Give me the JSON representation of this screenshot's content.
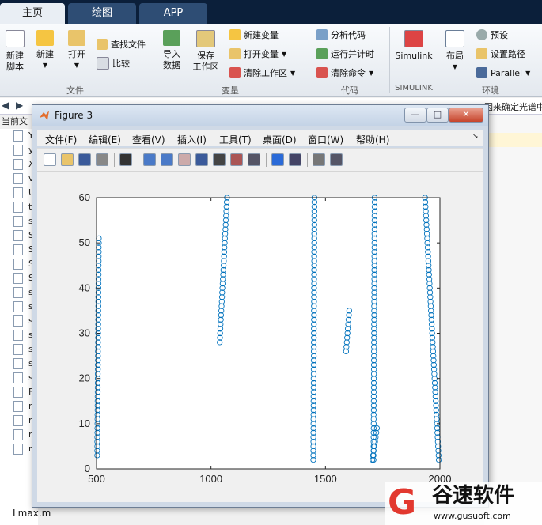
{
  "ribbon": {
    "tabs": [
      "主页",
      "绘图",
      "APP"
    ],
    "buttons": {
      "new_script": "新建\n脚本",
      "new": "新建",
      "open": "打开",
      "find_files": "查找文件",
      "compare": "比较",
      "import": "导入\n数据",
      "save_workspace": "保存\n工作区",
      "new_variable": "新建变量",
      "open_variable": "打开变量",
      "clear_workspace": "清除工作区",
      "analyze_code": "分析代码",
      "run_time": "运行并计时",
      "clear_commands": "清除命令",
      "simulink": "Simulink",
      "layout": "布局",
      "preferences": "预设",
      "set_path": "设置路径",
      "parallel": "Parallel"
    },
    "groups": [
      "文件",
      "变量",
      "代码",
      "SIMULINK",
      "环境"
    ]
  },
  "desktop": {
    "current_folder_label": "当前文",
    "path_tail": "因来确定光谱中",
    "file_initials": [
      "Y",
      "y",
      "X",
      "v",
      "U",
      "t",
      "s",
      "S",
      "S",
      "S",
      "S",
      "s",
      "s",
      "s",
      "s",
      "s",
      "s",
      "s",
      "F",
      "r",
      "r",
      "r",
      "r"
    ],
    "last_file": "Lmax.m"
  },
  "figure": {
    "title": "Figure 3",
    "controls": {
      "minimize": "—",
      "maximize": "□",
      "close": "✕"
    },
    "menus": [
      "文件(F)",
      "编辑(E)",
      "查看(V)",
      "插入(I)",
      "工具(T)",
      "桌面(D)",
      "窗口(W)",
      "帮助(H)"
    ],
    "toolbar_icons": [
      "new-figure-icon",
      "open-icon",
      "save-icon",
      "print-icon",
      "pointer-icon",
      "zoom-in-icon",
      "zoom-out-icon",
      "pan-icon",
      "rotate-icon",
      "data-cursor-icon",
      "brush-icon",
      "link-icon",
      "colorbar-icon",
      "legend-icon",
      "hide-plot-tools-icon",
      "show-plot-tools-icon"
    ]
  },
  "chart_data": {
    "type": "scatter",
    "marker": "open-circle",
    "color": "#0072bd",
    "xlim": [
      500,
      2000
    ],
    "ylim": [
      0,
      60
    ],
    "xticks": [
      500,
      1000,
      1500,
      2000
    ],
    "yticks": [
      0,
      10,
      20,
      30,
      40,
      50,
      60
    ],
    "title": "",
    "xlabel": "",
    "ylabel": "",
    "series": [
      {
        "x_start": 503,
        "x_end": 510,
        "y_start": 3,
        "y_end": 51,
        "count": 49
      },
      {
        "x_start": 1038,
        "x_end": 1070,
        "y_start": 28,
        "y_end": 60,
        "count": 33
      },
      {
        "x_start": 1447,
        "x_end": 1452,
        "y_start": 2,
        "y_end": 60,
        "count": 59
      },
      {
        "x_start": 1590,
        "x_end": 1604,
        "y_start": 26,
        "y_end": 35,
        "count": 10
      },
      {
        "x_start": 1710,
        "x_end": 1715,
        "y_start": 2,
        "y_end": 60,
        "count": 59
      },
      {
        "x_start": 1705,
        "x_end": 1725,
        "y_start": 2,
        "y_end": 9,
        "count": 8
      },
      {
        "x_start": 1995,
        "x_end": 1935,
        "y_start": 2,
        "y_end": 60,
        "count": 59
      }
    ]
  },
  "watermark": {
    "brand": "谷速软件",
    "url": "www.gusuoft.com"
  }
}
